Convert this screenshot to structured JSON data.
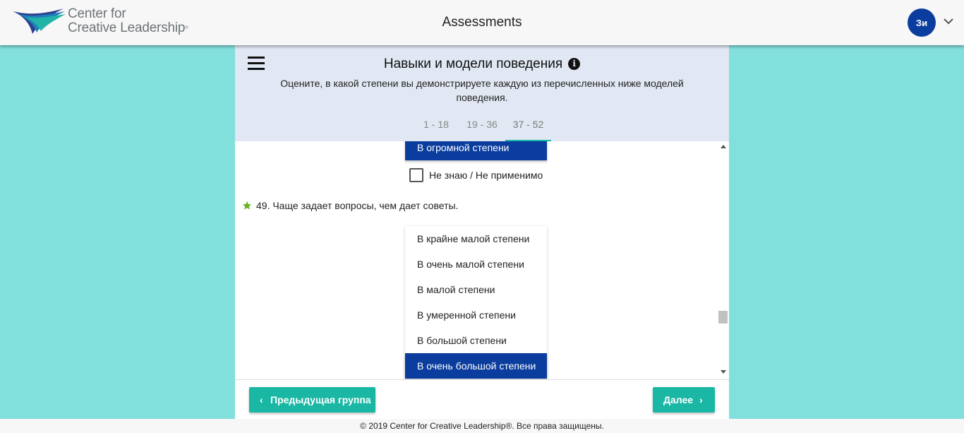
{
  "header": {
    "logo_line1": "Center for",
    "logo_line2": "Creative Leadership",
    "app_title": "Assessments",
    "avatar_initials": "Зи",
    "colors": {
      "avatar": "#0a3d9e",
      "background": "#82e0dc",
      "accent": "#1bb7a5"
    }
  },
  "section": {
    "title": "Навыки и модели поведения",
    "description": "Оцените, в какой степени вы демонстрируете каждую из перечисленных ниже моделей поведения.",
    "info_icon": "info-icon"
  },
  "tabs": [
    {
      "label": "1 - 18",
      "active": false
    },
    {
      "label": "19 - 36",
      "active": false
    },
    {
      "label": "37 - 52",
      "active": true
    }
  ],
  "prev_question": {
    "selected_option": "В огромной степени",
    "not_applicable_label": "Не знаю / Не применимо",
    "not_applicable_checked": false
  },
  "question": {
    "text": "49. Чаще задает вопросы, чем дает советы.",
    "icon": "star-icon",
    "options": [
      {
        "label": "В крайне малой степени",
        "selected": false
      },
      {
        "label": "В очень малой степени",
        "selected": false
      },
      {
        "label": "В малой степени",
        "selected": false
      },
      {
        "label": "В умеренной степени",
        "selected": false
      },
      {
        "label": "В большой степени",
        "selected": false
      },
      {
        "label": "В очень большой степени",
        "selected": true
      }
    ]
  },
  "nav": {
    "prev_label": "Предыдущая группа",
    "next_label": "Далее"
  },
  "footer": {
    "copyright": "© 2019 Center for Creative Leadership®. Все права защищены."
  }
}
